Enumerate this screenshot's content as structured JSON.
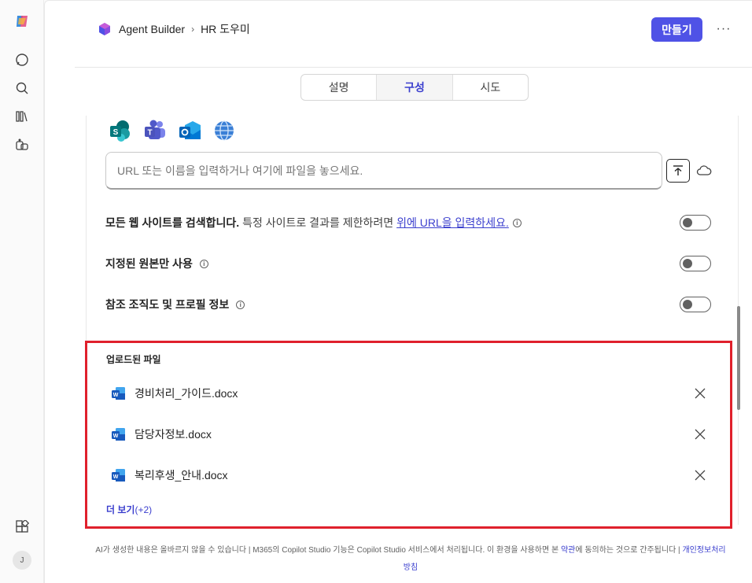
{
  "app": {
    "name": "Copilot"
  },
  "breadcrumb": {
    "root": "Agent Builder",
    "current": "HR 도우미"
  },
  "header": {
    "create_label": "만들기",
    "more_label": "···"
  },
  "tabs": [
    {
      "label": "설명",
      "active": false
    },
    {
      "label": "구성",
      "active": true
    },
    {
      "label": "시도",
      "active": false
    }
  ],
  "knowledge": {
    "source_icons": [
      "sharepoint-icon",
      "teams-icon",
      "outlook-icon",
      "web-globe-icon"
    ],
    "url_placeholder": "URL 또는 이름을 입력하거나 여기에 파일을 놓으세요.",
    "options": [
      {
        "bold": "모든 웹 사이트를 검색합니다.",
        "desc": "특정 사이트로 결과를 제한하려면",
        "link": "위에 URL을 입력하세요.",
        "enabled": false
      },
      {
        "bold": "지정된 원본만 사용",
        "desc": "",
        "link": "",
        "enabled": false
      },
      {
        "bold": "참조 조직도 및 프로필 정보",
        "desc": "",
        "link": "",
        "enabled": false
      }
    ]
  },
  "uploaded": {
    "title": "업로드된 파일",
    "files": [
      {
        "name": "경비처리_가이드.docx",
        "icon": "word-doc-icon"
      },
      {
        "name": "담당자정보.docx",
        "icon": "word-doc-icon"
      },
      {
        "name": "복리후생_안내.docx",
        "icon": "word-doc-icon"
      }
    ],
    "see_more": "더 보기",
    "see_more_count": "(+2)"
  },
  "footer": {
    "text_1": "AI가 생성한 내용은 올바르지 않을 수 있습니다 | M365의 Copilot Studio 기능은 Copilot Studio 서비스에서 처리됩니다. 이 환경을 사용하면 본 ",
    "terms": "약관",
    "text_2": "에 동의하는 것으로 간주됩니다 | ",
    "privacy": "개인정보처리방침"
  },
  "user": {
    "initial": "J"
  },
  "colors": {
    "accent": "#4f52e6",
    "highlight": "#e0202c"
  }
}
